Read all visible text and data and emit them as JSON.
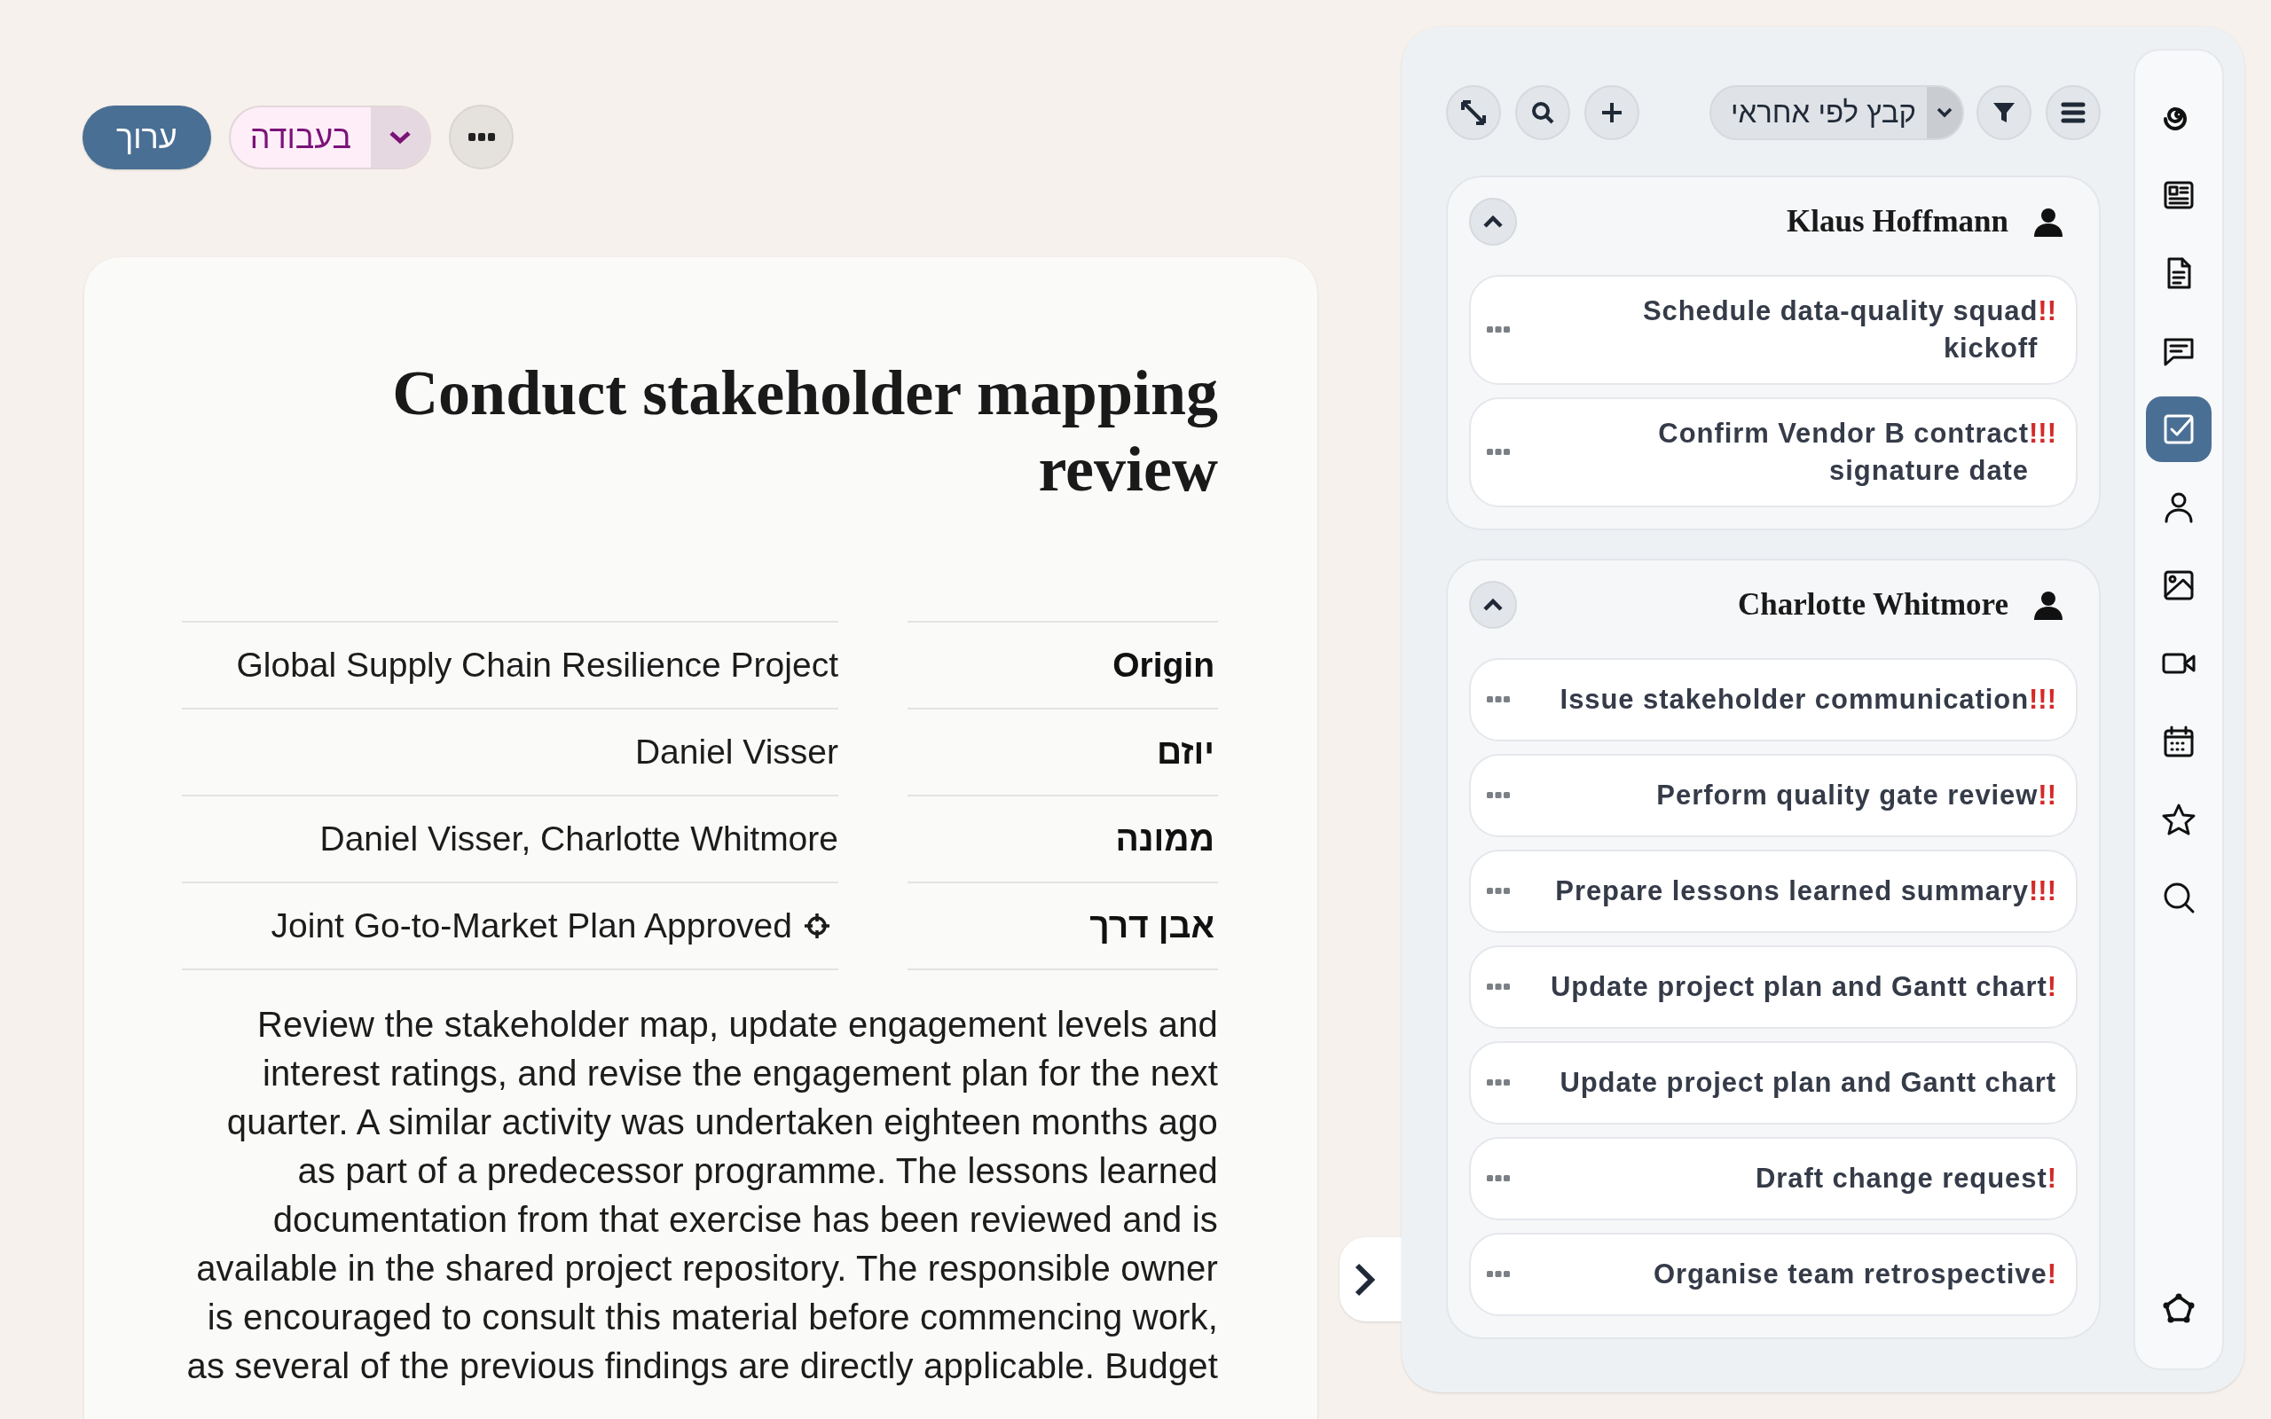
{
  "toolbar": {
    "edit_button": "ערוך",
    "status": {
      "label": "בעבודה"
    }
  },
  "task": {
    "title": "Conduct stakeholder mapping review",
    "details": [
      {
        "label": "Origin",
        "value": "Global Supply Chain Resilience Project",
        "kind": "text"
      },
      {
        "label": "יוזם",
        "value": "Daniel Visser",
        "kind": "text"
      },
      {
        "label": "ממונה",
        "value": "Daniel Visser, Charlotte Whitmore",
        "kind": "text"
      },
      {
        "label": "אבן דרך",
        "value": "Joint Go-to-Market Plan Approved",
        "kind": "milestone"
      }
    ],
    "description": "Review the stakeholder map, update engagement levels and interest ratings, and revise the engagement plan for the next quarter. A similar activity was undertaken eighteen months ago as part of a predecessor programme. The lessons learned documentation from that exercise has been reviewed and is available in the shared project repository. The responsible owner is encouraged to consult this material before commencing work, as several of the previous findings are directly applicable. Budget"
  },
  "panel": {
    "group_by": "קבץ לפי אחראי",
    "groups": [
      {
        "assignee": "Klaus Hoffmann",
        "expanded": true,
        "tasks": [
          {
            "title": "Schedule data-quality squad kickoff",
            "priority": "!!"
          },
          {
            "title": "Confirm Vendor B contract signature date",
            "priority": "!!!"
          }
        ]
      },
      {
        "assignee": "Charlotte Whitmore",
        "expanded": true,
        "tasks": [
          {
            "title": "Issue stakeholder communication",
            "priority": "!!!"
          },
          {
            "title": "Perform quality gate review",
            "priority": "!!"
          },
          {
            "title": "Prepare lessons learned summary",
            "priority": "!!!"
          },
          {
            "title": "Update project plan and Gantt chart",
            "priority": "!"
          },
          {
            "title": "Update project plan and Gantt chart"
          },
          {
            "title": "Draft change request",
            "priority": "!"
          },
          {
            "title": "Organise team retrospective",
            "priority": "!"
          }
        ]
      }
    ]
  },
  "rail": [
    {
      "selected": false
    },
    {
      "selected": false
    },
    {
      "selected": false
    },
    {
      "selected": false
    },
    {
      "selected": true
    },
    {
      "selected": false
    },
    {
      "selected": false
    },
    {
      "selected": false
    },
    {
      "selected": false
    },
    {
      "selected": false
    },
    {
      "selected": false
    },
    {
      "selected": false
    }
  ]
}
